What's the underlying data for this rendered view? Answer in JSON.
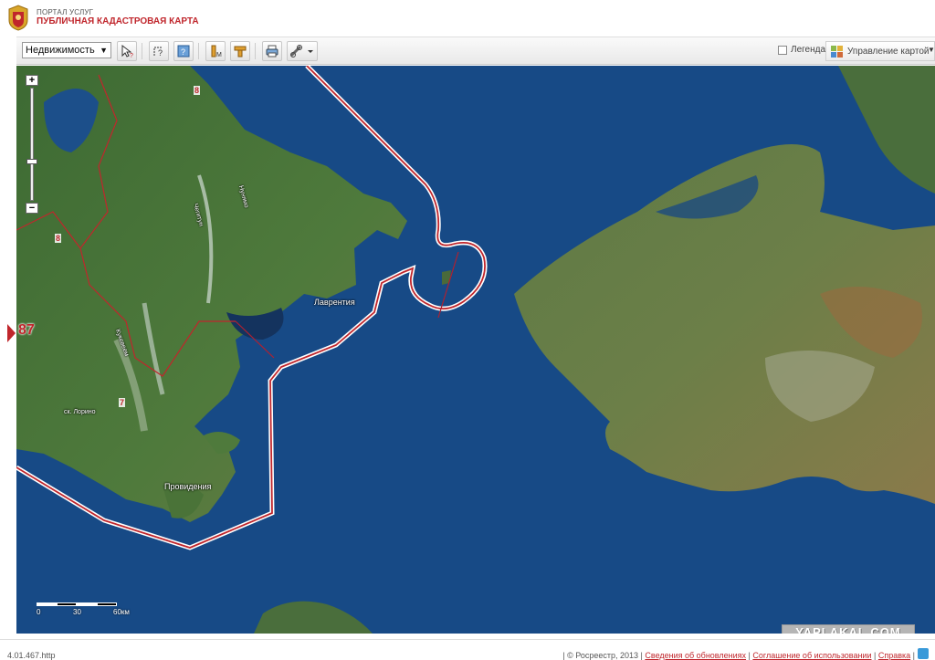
{
  "header": {
    "portal_label": "ПОРТАЛ УСЛУГ",
    "title": "ПУБЛИЧНАЯ КАДАСТРОВАЯ КАРТА"
  },
  "toolbar": {
    "layer_select": "Недвижимость",
    "legend_label": "Легенда",
    "map_control_label": "Управление картой"
  },
  "map": {
    "region_marker": "87",
    "labels": {
      "lavrentiya": "Лаврентия",
      "provideniya": "Провидения",
      "lorino": "ск. Лорино",
      "river1": "Чегитун",
      "river2": "Нунямо",
      "river3": "Кукевеем"
    },
    "zone_numbers": [
      "8",
      "8",
      "7"
    ],
    "scale": {
      "zero": "0",
      "mid": "30",
      "max": "60км"
    },
    "watermark": "YAPLAKAL.COM"
  },
  "footer": {
    "version": "4.01.467.http",
    "copyright": "| © Росреестр, 2013 |",
    "link_updates": "Сведения об обновлениях",
    "link_terms": "Соглашение об использовании",
    "link_help": "Справка"
  },
  "colors": {
    "brand_red": "#c0262c",
    "sea": "#174a86",
    "land": "#4a6e3c"
  }
}
